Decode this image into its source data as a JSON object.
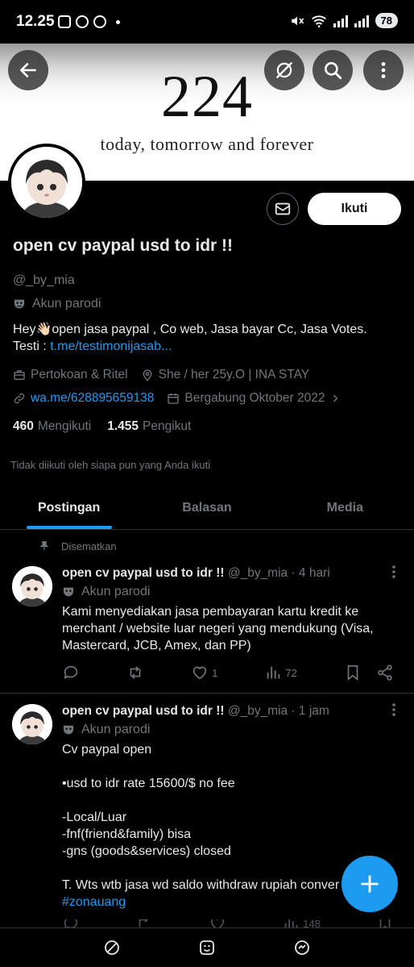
{
  "status_bar": {
    "time": "12.25",
    "battery": "78"
  },
  "banner": {
    "title": "224",
    "subtitle": "today, tomorrow and forever"
  },
  "header_icons": [
    "back-arrow-icon",
    "grok-icon",
    "search-icon",
    "more-vertical-icon"
  ],
  "profile": {
    "name": "open cv paypal usd to idr !!",
    "handle": "@_by_mia",
    "parody_label": "Akun parodi",
    "bio_line1": "Hey👋🏻open jasa paypal , Co web, Jasa bayar Cc, Jasa Votes.",
    "bio_testi_label": "Testi : ",
    "bio_link": "t.me/testimonijasab...",
    "category": "Pertokoan & Ritel",
    "location": "She / her 25y.O | INA STAY",
    "website": "wa.me/628895659138",
    "joined": "Bergabung Oktober 2022",
    "following_count": "460",
    "following_label": "Mengikuti",
    "followers_count": "1.455",
    "followers_label": "Pengikut",
    "not_followed_note": "Tidak diikuti oleh siapa pun yang Anda ikuti",
    "follow_label": "Ikuti"
  },
  "tabs": [
    "Postingan",
    "Balasan",
    "Media"
  ],
  "active_tab": "Postingan",
  "pinned_label": "Disematkan",
  "posts": [
    {
      "name": "open cv paypal usd to idr !!",
      "meta": " @_by_mia · 4 hari",
      "parody": "Akun parodi",
      "body": "Kami menyediakan jasa pembayaran kartu kredit ke merchant / website luar negeri yang mendukung (Visa, Mastercard, JCB, Amex, dan PP)",
      "likes": "1",
      "views": "72"
    },
    {
      "name": "open cv paypal usd to idr !!",
      "meta": " @_by_mia · 1 jam",
      "parody": "Akun parodi",
      "body": "Cv paypal open\n\n•usd to idr rate 15600/$ no fee\n\n-Local/Luar\n-fnf(friend&family) bisa\n-gns (goods&services) closed\n\nT. Wts wtb jasa wd saldo withdraw rupiah conver",
      "hashtag": "#zonauang",
      "views": "148"
    }
  ],
  "colors": {
    "accent": "#1d9bf0",
    "background": "#000000",
    "muted": "#71767b",
    "text": "#e7e9ea"
  }
}
